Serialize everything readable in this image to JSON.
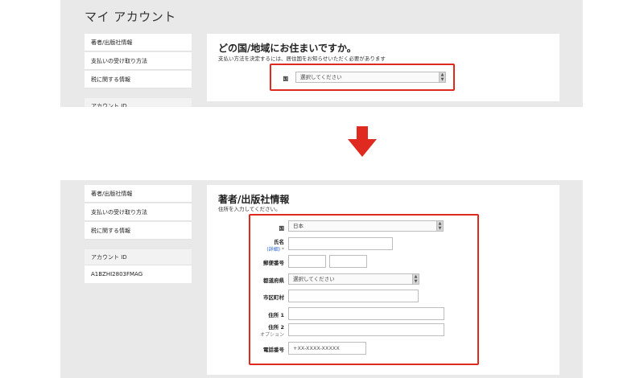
{
  "top": {
    "account_title": "マイ アカウント",
    "sidebar": [
      {
        "label": "著者/出版社情報"
      },
      {
        "label": "支払いの受け取り方法"
      },
      {
        "label": "税に関する情報"
      }
    ],
    "account_id_header": "アカウント ID",
    "question_title": "どの国/地域にお住まいですか。",
    "question_sub": "支払い方法を決定するには、居住国をお知らせいただく必要があります",
    "country_label": "国",
    "country_select": "選択してください"
  },
  "bottom": {
    "sidebar": [
      {
        "label": "著者/出版社情報"
      },
      {
        "label": "支払いの受け取り方法"
      },
      {
        "label": "税に関する情報"
      }
    ],
    "account_id_header": "アカウント ID",
    "account_id_value": "A1BZHI2803FMAG",
    "section_title": "著者/出版社情報",
    "section_sub": "住所を入力してください。",
    "form": {
      "country_label": "国",
      "country_value": "日本",
      "name_label": "氏名",
      "name_detail": "(詳細)",
      "name_required": "*",
      "postal_label": "郵便番号",
      "prefecture_label": "都道府県",
      "prefecture_value": "選択してください",
      "city_label": "市区町村",
      "address1_label": "住所 1",
      "address2_label": "住所 2",
      "address2_optional": "オプション",
      "phone_label": "電話番号",
      "phone_placeholder": "+XX-XXXX-XXXXX"
    }
  },
  "colors": {
    "highlight": "#e0291f",
    "arrow": "#e0291f",
    "panel_bg": "#e9e9e9",
    "link": "#2a66c6"
  },
  "icons": {
    "select_arrow": "updown-chevron-icon",
    "transition_arrow": "down-arrow-icon"
  }
}
